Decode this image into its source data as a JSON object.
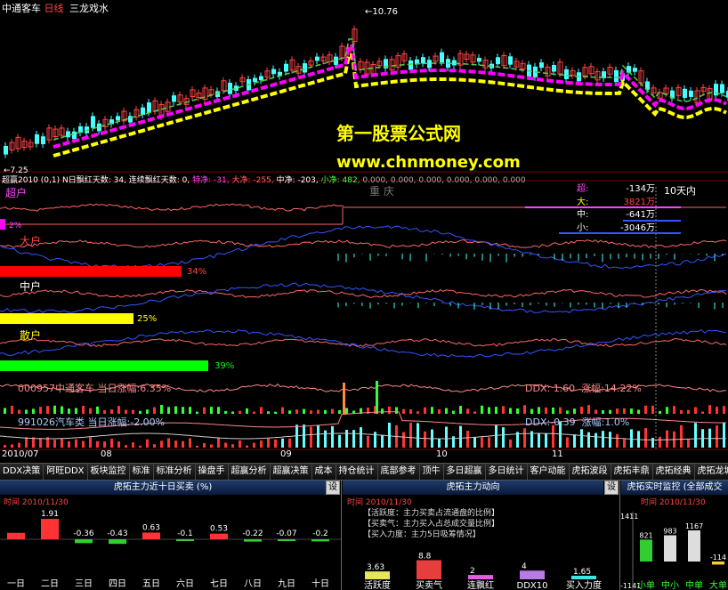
{
  "header": {
    "stock": "中通客车",
    "period": "日线",
    "indicator": "三龙戏水",
    "high_price": "10.76",
    "low_price": "7.25"
  },
  "watermark": {
    "line1": "第一股票公式网",
    "line2": "www.chnmoney.com"
  },
  "indicator_bar": {
    "name": "超赢2010 (0,1)",
    "parts": [
      "N日飘红天数: 34, 连续飘红天数: 0,",
      "特净: -31,",
      "大净: -255,",
      "中净: -203,",
      "小净: 482,",
      "0.000, 0.000, 0.000, 0.000, 0.000, 0.000"
    ],
    "colors": [
      "#ffffff",
      "#ff44ff",
      "#ff6666",
      "#ffffff",
      "#44ff44",
      "#888888"
    ]
  },
  "ten_day": {
    "title": "10天内",
    "rows": [
      {
        "label": "超:",
        "value": "-134万",
        "color": "#ff44ff"
      },
      {
        "label": "大:",
        "value": "3821万",
        "color": "#ffff00"
      },
      {
        "label": "中:",
        "value": "-641万",
        "color": "#ffffff"
      },
      {
        "label": "小:",
        "value": "-3046万",
        "color": "#ffffff"
      }
    ]
  },
  "bands": {
    "chao": {
      "label": "超户",
      "pct": "2%",
      "color": "#ff00ff",
      "fill": 0.02
    },
    "da": {
      "label": "大户",
      "pct": "34%",
      "color": "#ff0000",
      "fill": 0.34
    },
    "zhong": {
      "label": "中户",
      "pct": "25%",
      "color": "#ffff00",
      "fill": 0.25
    },
    "san": {
      "label": "散户",
      "pct": "39%",
      "color": "#00ff00",
      "fill": 0.39
    }
  },
  "event_label": "重 庆",
  "stock_line": {
    "code": "000957",
    "name": "中通客车",
    "label": "当日涨幅:",
    "change": "6.35%",
    "ddx_label": "DDX:",
    "ddx": "1.60",
    "zf_label": "涨幅:",
    "zf": "14.22%"
  },
  "sector_line": {
    "code": "991026",
    "name": "汽车类",
    "label": "当日涨幅:",
    "change": "-2.00%",
    "ddx_label": "DDX:",
    "ddx": "-0.39",
    "zf_label": "涨幅:",
    "zf": "1.0%"
  },
  "timeline": [
    "2010/07",
    "08",
    "09",
    "10",
    "11"
  ],
  "tabs": [
    "DDX决策",
    "阿旺DDX",
    "板块监控",
    "标准",
    "标准分析",
    "操盘手",
    "超赢分析",
    "超赢决策",
    "成本",
    "持仓统计",
    "底部参考",
    "顶牛",
    "多日超赢",
    "多日统计",
    "客户动能",
    "虎拓波段",
    "虎拓丰鼎",
    "虎拓经典",
    "虎拓龙城"
  ],
  "panel1": {
    "title": "虎拓主力近十日买卖 (%)",
    "settings": "设",
    "date": "2010/11/30",
    "days": [
      "一日",
      "二日",
      "三日",
      "四日",
      "五日",
      "六日",
      "七日",
      "八日",
      "九日",
      "十日"
    ],
    "values": [
      "",
      "1.91",
      "-0.36",
      "-0.43",
      "0.63",
      "-0.1",
      "0.53",
      "-0.22",
      "-0.07",
      "-0.2"
    ],
    "nums": [
      0.6,
      1.91,
      -0.36,
      -0.43,
      0.63,
      -0.1,
      0.53,
      -0.22,
      -0.07,
      -0.2
    ]
  },
  "panel2": {
    "title": "虎拓主力动向",
    "settings": "设",
    "date": "2010/11/30",
    "notes": [
      "【活跃度：主力买卖占流通盘的比例】",
      "【买卖气：主力买入占总成交量比例】",
      "【买入力度：主力5日吸筹情况】"
    ],
    "bars": [
      {
        "label": "活跃度",
        "value": "3.63",
        "num": 3.63,
        "color": "#ffff66"
      },
      {
        "label": "买卖气",
        "value": "8.8",
        "num": 8.8,
        "color": "#ff4444"
      },
      {
        "label": "连飘红",
        "value": "2",
        "num": 2,
        "color": "#ff66ff"
      },
      {
        "label": "DDX10",
        "value": "4",
        "num": 4,
        "color": "#cc88ff"
      },
      {
        "label": "买入力度",
        "value": "1.65",
        "num": 1.65,
        "color": "#44ffff"
      }
    ]
  },
  "panel3": {
    "title": "虎拓实时监控 (全部成交",
    "time_label": "时间",
    "date": "2010/11/30",
    "cats": [
      "小单",
      "中小",
      "中单",
      "大单"
    ],
    "values": [
      "821",
      "983",
      "1167",
      "-114"
    ],
    "nums": [
      821,
      983,
      1167,
      -114
    ],
    "colors": [
      "#33cc33",
      "#dddddd",
      "#dddddd",
      "#ffcc33"
    ],
    "axis_top": "1411",
    "axis_bottom": "-1141"
  }
}
